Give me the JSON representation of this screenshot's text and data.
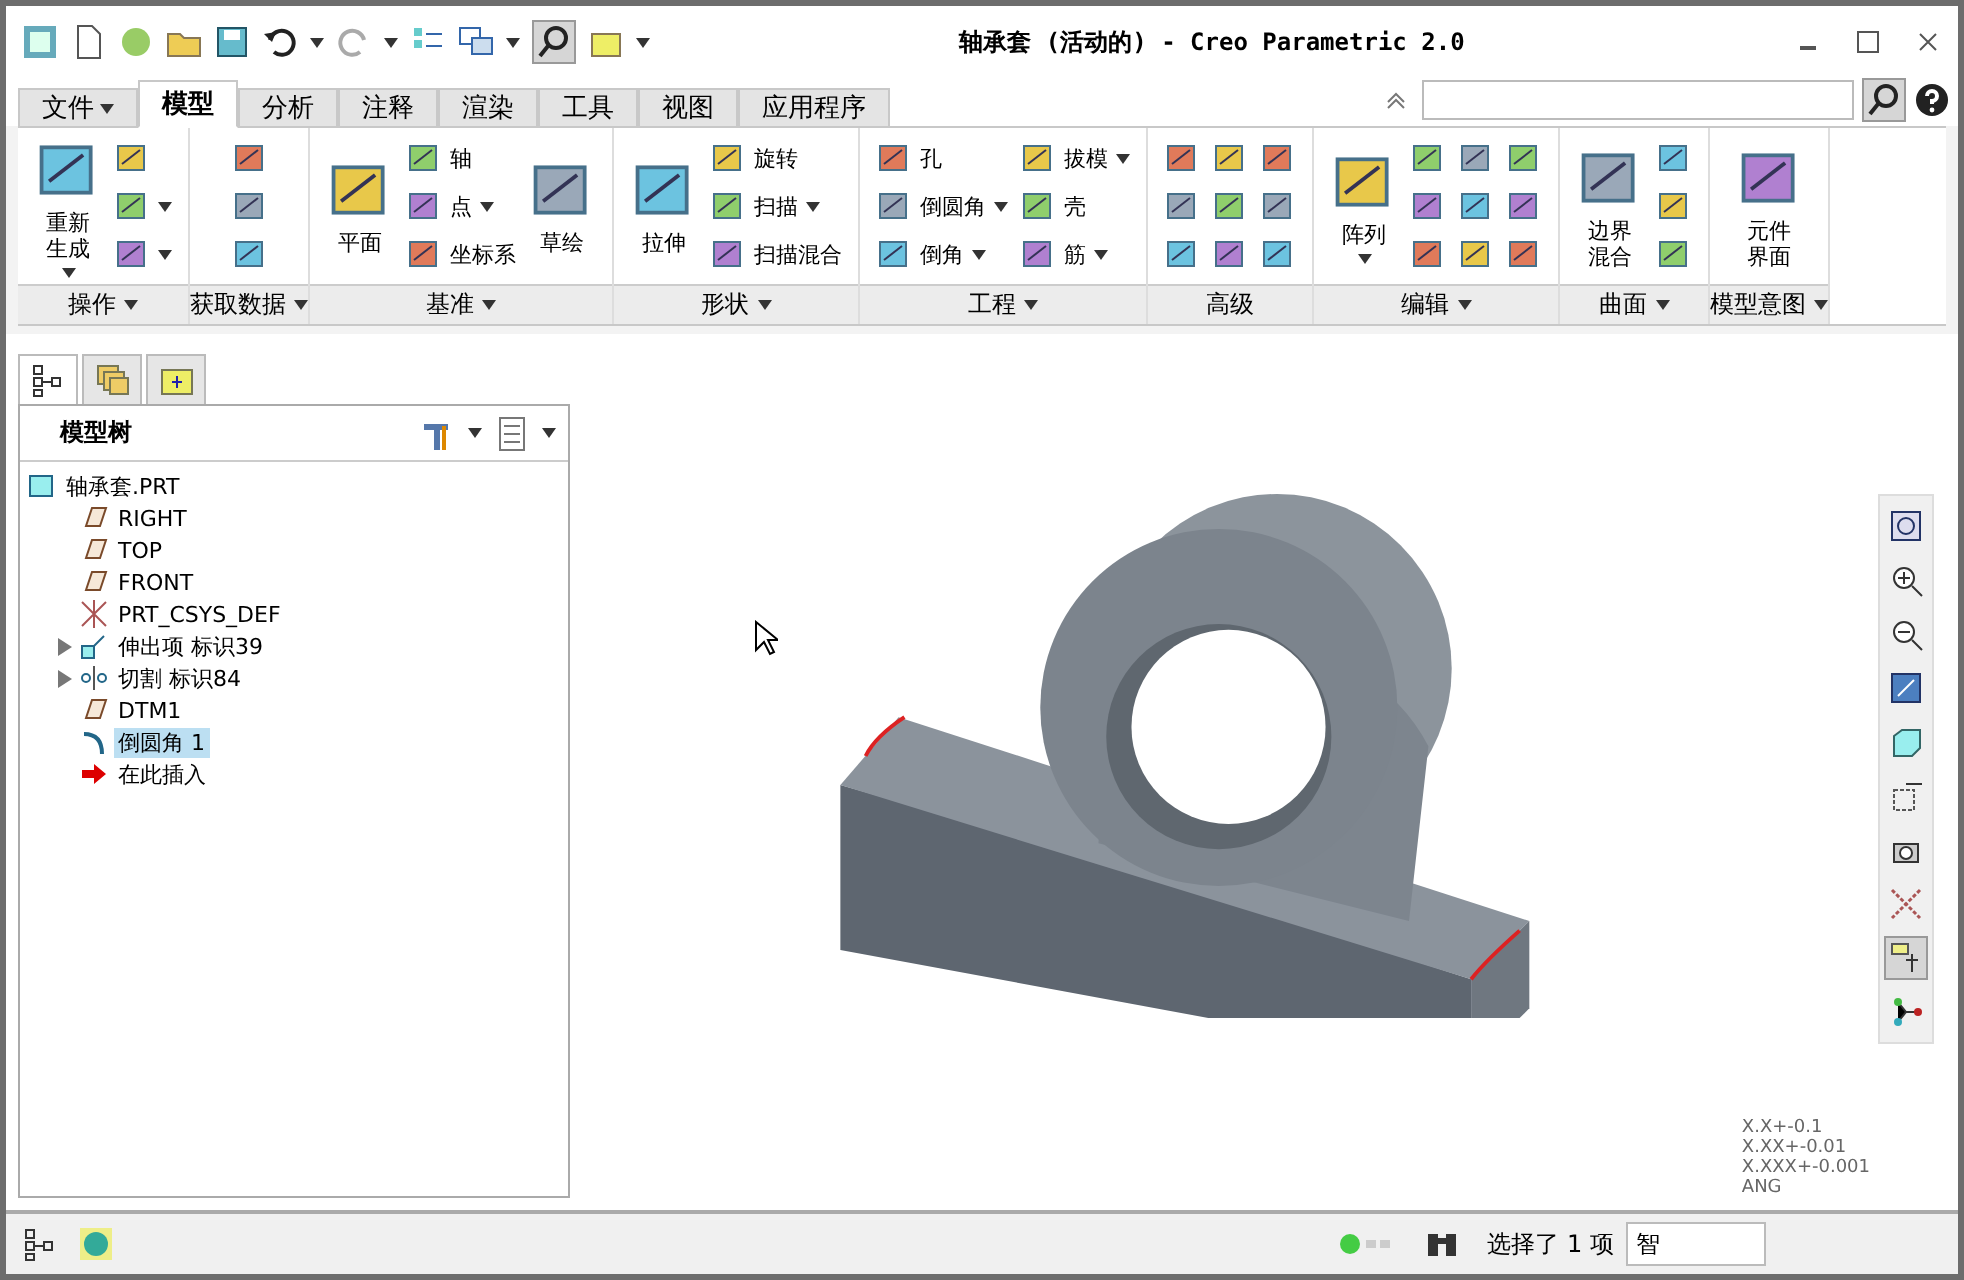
{
  "window": {
    "title": "轴承套 (活动的) - Creo Parametric 2.0"
  },
  "tabs": [
    {
      "label": "文件",
      "kind": "menu",
      "selected": false
    },
    {
      "label": "模型",
      "kind": "tab",
      "selected": true
    },
    {
      "label": "分析",
      "kind": "tab",
      "selected": false
    },
    {
      "label": "注释",
      "kind": "tab",
      "selected": false
    },
    {
      "label": "渲染",
      "kind": "tab",
      "selected": false
    },
    {
      "label": "工具",
      "kind": "tab",
      "selected": false
    },
    {
      "label": "视图",
      "kind": "tab",
      "selected": false
    },
    {
      "label": "应用程序",
      "kind": "tab",
      "selected": false
    }
  ],
  "ribbon": [
    {
      "label": "操作",
      "dropdown": true,
      "columns": [
        [
          {
            "kind": "large",
            "label": "重新生成",
            "dropdown": true
          }
        ],
        [
          {
            "kind": "icon"
          },
          {
            "kind": "icon",
            "dropdown": true
          },
          {
            "kind": "icon",
            "dropdown": true
          }
        ]
      ]
    },
    {
      "label": "获取数据",
      "dropdown": true,
      "columns": [
        [
          {
            "kind": "icon"
          },
          {
            "kind": "icon"
          },
          {
            "kind": "icon"
          }
        ]
      ]
    },
    {
      "label": "基准",
      "dropdown": true,
      "columns": [
        [
          {
            "kind": "large",
            "label": "平面"
          }
        ],
        [
          {
            "kind": "small",
            "label": "轴"
          },
          {
            "kind": "small",
            "label": "点",
            "dropdown": true
          },
          {
            "kind": "small",
            "label": "坐标系"
          }
        ],
        [
          {
            "kind": "large",
            "label": "草绘"
          }
        ]
      ]
    },
    {
      "label": "形状",
      "dropdown": true,
      "columns": [
        [
          {
            "kind": "large",
            "label": "拉伸"
          }
        ],
        [
          {
            "kind": "small",
            "label": "旋转"
          },
          {
            "kind": "small",
            "label": "扫描",
            "dropdown": true
          },
          {
            "kind": "small",
            "label": "扫描混合"
          }
        ]
      ]
    },
    {
      "label": "工程",
      "dropdown": true,
      "columns": [
        [
          {
            "kind": "small",
            "label": "孔"
          },
          {
            "kind": "small",
            "label": "倒圆角",
            "dropdown": true
          },
          {
            "kind": "small",
            "label": "倒角",
            "dropdown": true
          }
        ],
        [
          {
            "kind": "small",
            "label": "拔模",
            "dropdown": true
          },
          {
            "kind": "small",
            "label": "壳"
          },
          {
            "kind": "small",
            "label": "筋",
            "dropdown": true
          }
        ]
      ]
    },
    {
      "label": "高级",
      "dropdown": false,
      "columns": [
        [
          {
            "kind": "icon"
          },
          {
            "kind": "icon"
          },
          {
            "kind": "icon"
          }
        ],
        [
          {
            "kind": "icon"
          },
          {
            "kind": "icon"
          },
          {
            "kind": "icon"
          }
        ],
        [
          {
            "kind": "icon"
          },
          {
            "kind": "icon"
          },
          {
            "kind": "icon"
          }
        ]
      ]
    },
    {
      "label": "编辑",
      "dropdown": true,
      "columns": [
        [
          {
            "kind": "large",
            "label": "阵列",
            "dropdown": true
          }
        ],
        [
          {
            "kind": "icon"
          },
          {
            "kind": "icon"
          },
          {
            "kind": "icon"
          }
        ],
        [
          {
            "kind": "icon"
          },
          {
            "kind": "icon"
          },
          {
            "kind": "icon"
          }
        ],
        [
          {
            "kind": "icon"
          },
          {
            "kind": "icon"
          },
          {
            "kind": "icon"
          }
        ]
      ]
    },
    {
      "label": "曲面",
      "dropdown": true,
      "columns": [
        [
          {
            "kind": "large",
            "label": "边界混合"
          }
        ],
        [
          {
            "kind": "icon"
          },
          {
            "kind": "icon"
          },
          {
            "kind": "icon"
          }
        ]
      ]
    },
    {
      "label": "模型意图",
      "dropdown": true,
      "columns": [
        [
          {
            "kind": "large",
            "label": "元件界面"
          }
        ]
      ]
    }
  ],
  "navigator_tabs": [
    {
      "kind": "tree",
      "selected": true
    },
    {
      "kind": "layers",
      "selected": false
    },
    {
      "kind": "favorites",
      "selected": false
    }
  ],
  "model_tree": {
    "title": "模型树",
    "items": [
      {
        "label": "轴承套.PRT",
        "kind": "part",
        "selected": false,
        "children": [
          {
            "label": "RIGHT",
            "kind": "plane",
            "selected": false
          },
          {
            "label": "TOP",
            "kind": "plane",
            "selected": false
          },
          {
            "label": "FRONT",
            "kind": "plane",
            "selected": false
          },
          {
            "label": "PRT_CSYS_DEF",
            "kind": "csys",
            "selected": false
          },
          {
            "label": "伸出项 标识39",
            "kind": "extrude",
            "selected": false,
            "expanded": false
          },
          {
            "label": "切割 标识84",
            "kind": "revolve",
            "selected": false,
            "expanded": false
          },
          {
            "label": "DTM1",
            "kind": "plane",
            "selected": false
          },
          {
            "label": "倒圆角 1",
            "kind": "round",
            "selected": true
          },
          {
            "label": "在此插入",
            "kind": "insert",
            "selected": false
          }
        ]
      }
    ]
  },
  "view_tools": [
    {
      "kind": "refit",
      "selected": false
    },
    {
      "kind": "zoom-in",
      "selected": false
    },
    {
      "kind": "zoom-out",
      "selected": false
    },
    {
      "kind": "repaint",
      "selected": false
    },
    {
      "kind": "display-style",
      "selected": false
    },
    {
      "kind": "orientation",
      "selected": false
    },
    {
      "kind": "saved-views",
      "selected": false
    },
    {
      "kind": "datum-display",
      "selected": false
    },
    {
      "kind": "annotation",
      "selected": true
    },
    {
      "kind": "spin-center",
      "selected": false
    }
  ],
  "tolerances": [
    "X.X+-0.1",
    "X.XX+-0.01",
    "X.XXX+-0.001",
    "ANG"
  ],
  "status_bar": {
    "message": "选择了 1 项",
    "filter": "智"
  }
}
